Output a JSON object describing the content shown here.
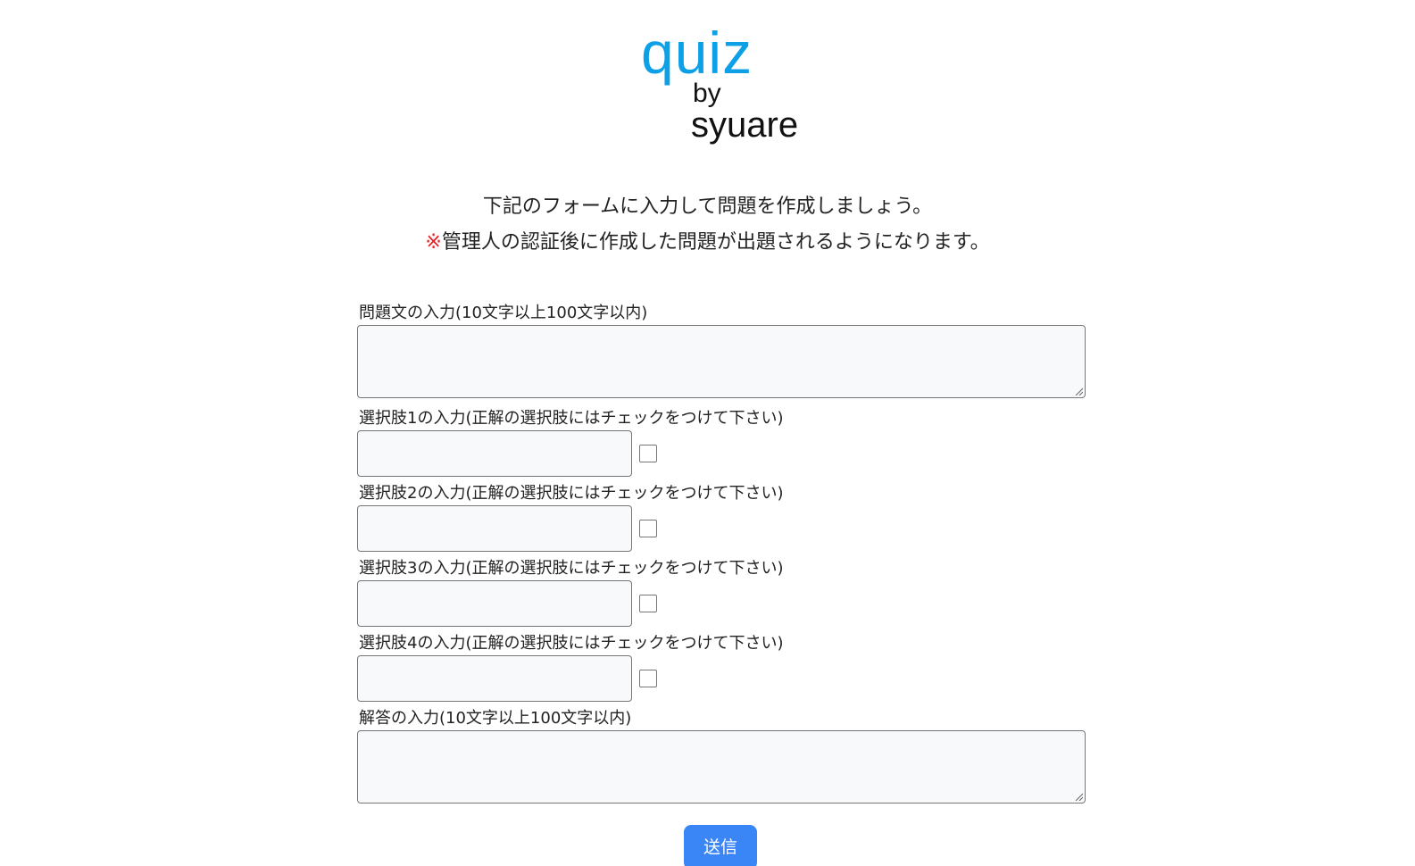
{
  "logo": {
    "title": "quiz",
    "by": "by",
    "author": "syuare",
    "title_color": "#0ea0e6"
  },
  "intro": {
    "line1": "下記のフォームに入力して問題を作成しましょう。",
    "line2_mark": "※",
    "line2_text": "管理人の認証後に作成した問題が出題されるようになります。",
    "mark_color": "#e0262a"
  },
  "form": {
    "question_label": "問題文の入力(10文字以上100文字以内)",
    "question_value": "",
    "choices": [
      {
        "label": "選択肢1の入力(正解の選択肢にはチェックをつけて下さい)",
        "value": "",
        "checked": false
      },
      {
        "label": "選択肢2の入力(正解の選択肢にはチェックをつけて下さい)",
        "value": "",
        "checked": false
      },
      {
        "label": "選択肢3の入力(正解の選択肢にはチェックをつけて下さい)",
        "value": "",
        "checked": false
      },
      {
        "label": "選択肢4の入力(正解の選択肢にはチェックをつけて下さい)",
        "value": "",
        "checked": false
      }
    ],
    "answer_label": "解答の入力(10文字以上100文字以内)",
    "answer_value": "",
    "submit_label": "送信",
    "submit_color": "#3b86f7"
  }
}
